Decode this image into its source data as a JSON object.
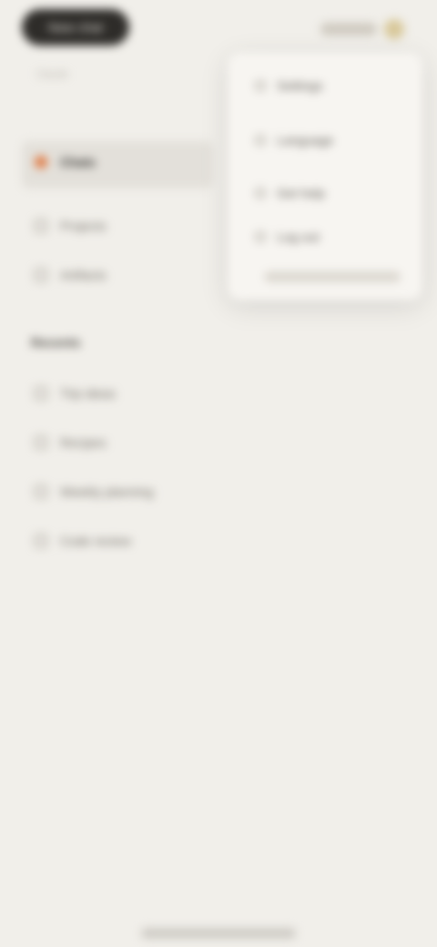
{
  "header": {
    "pill_label": "New chat",
    "subtext": "Claude",
    "avatar_color": "#d8c89a"
  },
  "sidebar": {
    "active_color": "#e07a43",
    "items": [
      {
        "label": "Chats",
        "icon": "chat-icon",
        "active": true
      },
      {
        "label": "Projects",
        "icon": "folder-icon",
        "active": false
      },
      {
        "label": "Artifacts",
        "icon": "artifact-icon",
        "active": false
      }
    ],
    "section_title": "Recents",
    "recents": [
      {
        "label": "Trip ideas",
        "icon": "chat-icon"
      },
      {
        "label": "Recipes",
        "icon": "chat-icon"
      },
      {
        "label": "Weekly planning",
        "icon": "chat-icon"
      },
      {
        "label": "Code review",
        "icon": "chat-icon"
      }
    ]
  },
  "dropdown": {
    "items": [
      {
        "label": "Settings",
        "icon": "gear-icon"
      },
      {
        "label": "Language",
        "icon": "globe-icon"
      },
      {
        "label": "Get help",
        "icon": "help-icon"
      },
      {
        "label": "Log out",
        "icon": "logout-icon"
      }
    ]
  }
}
